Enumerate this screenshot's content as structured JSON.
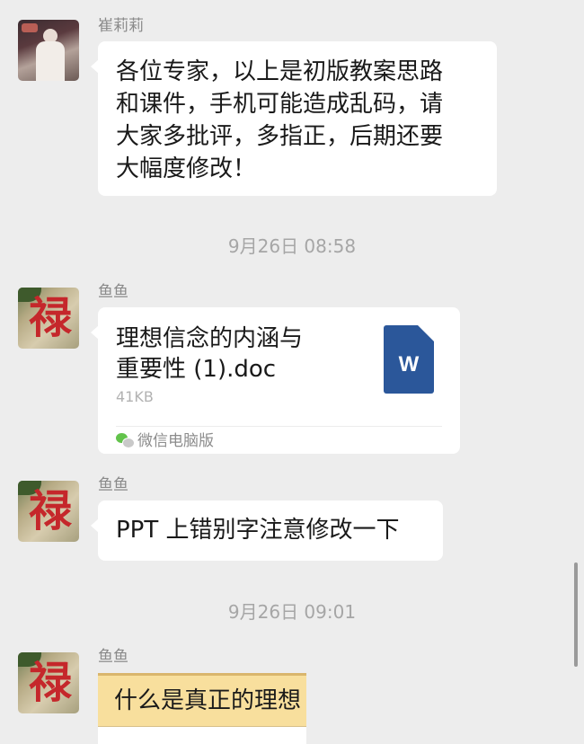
{
  "messages": [
    {
      "sender": "崔莉莉",
      "text_lines": [
        "各位专家，以上是初版教案思路",
        "和课件，手机可能造成乱码，请",
        "大家多批评，多指正，后期还要",
        "大幅度修改！"
      ]
    },
    {
      "timestamp": "9月26日 08:58"
    },
    {
      "sender": "鱼鱼",
      "file": {
        "title_lines": [
          "理想信念的内涵与",
          "重要性 (1).doc"
        ],
        "size": "41KB",
        "source": "微信电脑版",
        "icon_letter": "W"
      }
    },
    {
      "sender": "鱼鱼",
      "text": "PPT 上错别字注意修改一下"
    },
    {
      "timestamp": "9月26日 09:01"
    },
    {
      "sender": "鱼鱼",
      "link_card_text": "什么是真正的理想"
    }
  ],
  "colors": {
    "background": "#ededed",
    "bubble": "#ffffff",
    "word_icon": "#2b579a",
    "card_banner": "#f8df9d"
  },
  "icons": {
    "word_file": "word-doc-icon",
    "wechat": "wechat-icon"
  }
}
